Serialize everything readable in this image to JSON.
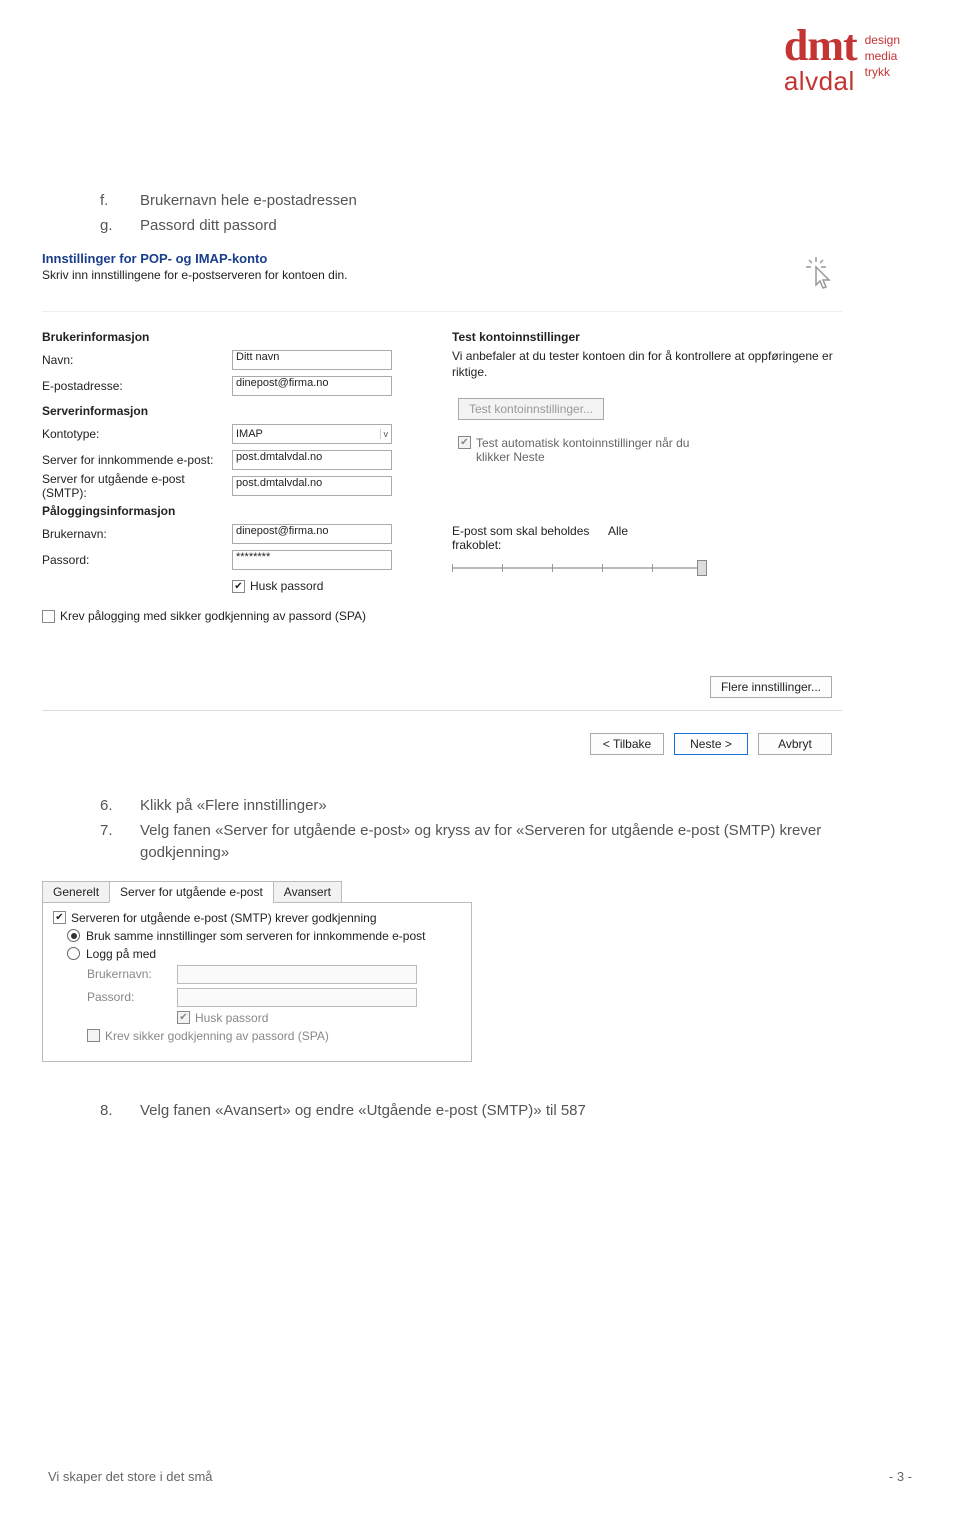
{
  "logo": {
    "main": "dmt",
    "sub": "alvdal",
    "tag1": "design",
    "tag2": "media",
    "tag3": "trykk"
  },
  "intro": {
    "f_marker": "f.",
    "f_text": "Brukernavn hele e-postadressen",
    "g_marker": "g.",
    "g_text": "Passord ditt passord"
  },
  "s1": {
    "title": "Innstillinger for POP- og IMAP-konto",
    "subtitle": "Skriv inn innstillingene for e-postserveren for kontoen din.",
    "h_userinfo": "Brukerinformasjon",
    "l_name": "Navn:",
    "v_name": "Ditt navn",
    "l_email": "E-postadresse:",
    "v_email": "dinepost@firma.no",
    "h_serverinfo": "Serverinformasjon",
    "l_type": "Kontotype:",
    "v_type": "IMAP",
    "l_in": "Server for innkommende e-post:",
    "v_in": "post.dmtalvdal.no",
    "l_out": "Server for utgående e-post (SMTP):",
    "v_out": "post.dmtalvdal.no",
    "h_login": "Påloggingsinformasjon",
    "l_user": "Brukernavn:",
    "v_user": "dinepost@firma.no",
    "l_pass": "Passord:",
    "v_pass": "********",
    "remember": "Husk passord",
    "spa": "Krev pålogging med sikker godkjenning av passord (SPA)",
    "h_test": "Test kontoinnstillinger",
    "test_para": "Vi anbefaler at du tester kontoen din for å kontrollere at oppføringene er riktige.",
    "test_btn": "Test kontoinnstillinger...",
    "auto_test": "Test automatisk kontoinnstillinger når du klikker Neste",
    "keep_lbl": "E-post som skal beholdes frakoblet:",
    "keep_val": "Alle",
    "more": "Flere innstillinger...",
    "back": "< Tilbake",
    "next": "Neste >",
    "cancel": "Avbryt"
  },
  "mid": {
    "six_marker": "6.",
    "six_text": "Klikk på «Flere innstillinger»",
    "seven_marker": "7.",
    "seven_text": "Velg fanen «Server for utgående e-post» og kryss av for «Serveren for utgående e-post (SMTP) krever godkjenning»"
  },
  "s2": {
    "tab1": "Generelt",
    "tab2": "Server for utgående e-post",
    "tab3": "Avansert",
    "chk_req": "Serveren for utgående e-post (SMTP) krever godkjenning",
    "opt_same": "Bruk samme innstillinger som serveren for innkommende e-post",
    "opt_loginwith": "Logg på med",
    "l_user": "Brukernavn:",
    "l_pass": "Passord:",
    "remember": "Husk passord",
    "spa": "Krev sikker godkjenning av passord (SPA)"
  },
  "step8": {
    "marker": "8.",
    "text": "Velg fanen «Avansert» og endre «Utgående e-post (SMTP)» til 587"
  },
  "footer": {
    "tagline": "Vi skaper det store i det små",
    "page": "- 3 -"
  }
}
